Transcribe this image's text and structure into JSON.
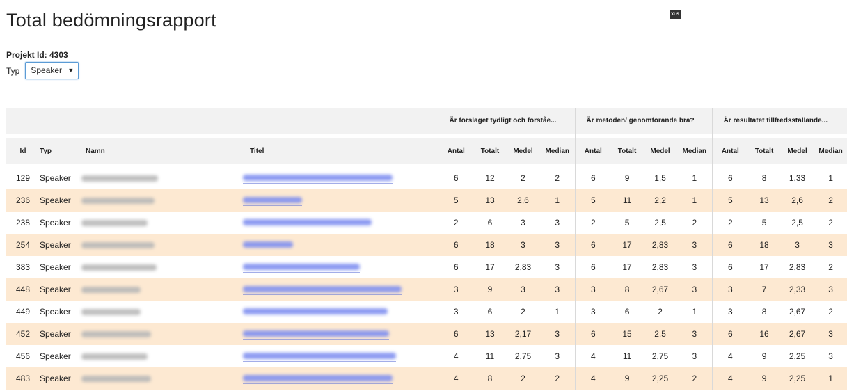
{
  "page": {
    "title": "Total bedömningsrapport",
    "project_label": "Projekt Id: 4303",
    "type_label": "Typ",
    "type_selected": "Speaker"
  },
  "icons": {
    "export": "xls-export-icon",
    "export_text": "XLS"
  },
  "table": {
    "groups": [
      "Är förslaget tydligt och förståe...",
      "Är metoden/ genomförande bra?",
      "Är resultatet tillfredsställande..."
    ],
    "columns": {
      "id": "Id",
      "typ": "Typ",
      "namn": "Namn",
      "titel": "Titel",
      "antal": "Antal",
      "totalt": "Totalt",
      "medel": "Medel",
      "median": "Median"
    },
    "rows": [
      {
        "id": "129",
        "typ": "Speaker",
        "g1": [
          "6",
          "12",
          "2",
          "2"
        ],
        "g2": [
          "6",
          "9",
          "1,5",
          "1"
        ],
        "g3": [
          "6",
          "8",
          "1,33",
          "1"
        ]
      },
      {
        "id": "236",
        "typ": "Speaker",
        "g1": [
          "5",
          "13",
          "2,6",
          "1"
        ],
        "g2": [
          "5",
          "11",
          "2,2",
          "1"
        ],
        "g3": [
          "5",
          "13",
          "2,6",
          "2"
        ]
      },
      {
        "id": "238",
        "typ": "Speaker",
        "g1": [
          "2",
          "6",
          "3",
          "3"
        ],
        "g2": [
          "2",
          "5",
          "2,5",
          "2"
        ],
        "g3": [
          "2",
          "5",
          "2,5",
          "2"
        ]
      },
      {
        "id": "254",
        "typ": "Speaker",
        "g1": [
          "6",
          "18",
          "3",
          "3"
        ],
        "g2": [
          "6",
          "17",
          "2,83",
          "3"
        ],
        "g3": [
          "6",
          "18",
          "3",
          "3"
        ]
      },
      {
        "id": "383",
        "typ": "Speaker",
        "g1": [
          "6",
          "17",
          "2,83",
          "3"
        ],
        "g2": [
          "6",
          "17",
          "2,83",
          "3"
        ],
        "g3": [
          "6",
          "17",
          "2,83",
          "2"
        ]
      },
      {
        "id": "448",
        "typ": "Speaker",
        "g1": [
          "3",
          "9",
          "3",
          "3"
        ],
        "g2": [
          "3",
          "8",
          "2,67",
          "3"
        ],
        "g3": [
          "3",
          "7",
          "2,33",
          "3"
        ]
      },
      {
        "id": "449",
        "typ": "Speaker",
        "g1": [
          "3",
          "6",
          "2",
          "1"
        ],
        "g2": [
          "3",
          "6",
          "2",
          "1"
        ],
        "g3": [
          "3",
          "8",
          "2,67",
          "2"
        ]
      },
      {
        "id": "452",
        "typ": "Speaker",
        "g1": [
          "6",
          "13",
          "2,17",
          "3"
        ],
        "g2": [
          "6",
          "15",
          "2,5",
          "3"
        ],
        "g3": [
          "6",
          "16",
          "2,67",
          "3"
        ]
      },
      {
        "id": "456",
        "typ": "Speaker",
        "g1": [
          "4",
          "11",
          "2,75",
          "3"
        ],
        "g2": [
          "4",
          "11",
          "2,75",
          "3"
        ],
        "g3": [
          "4",
          "9",
          "2,25",
          "3"
        ]
      },
      {
        "id": "483",
        "typ": "Speaker",
        "g1": [
          "4",
          "8",
          "2",
          "2"
        ],
        "g2": [
          "4",
          "9",
          "2,25",
          "2"
        ],
        "g3": [
          "4",
          "9",
          "2,25",
          "1"
        ]
      }
    ]
  }
}
